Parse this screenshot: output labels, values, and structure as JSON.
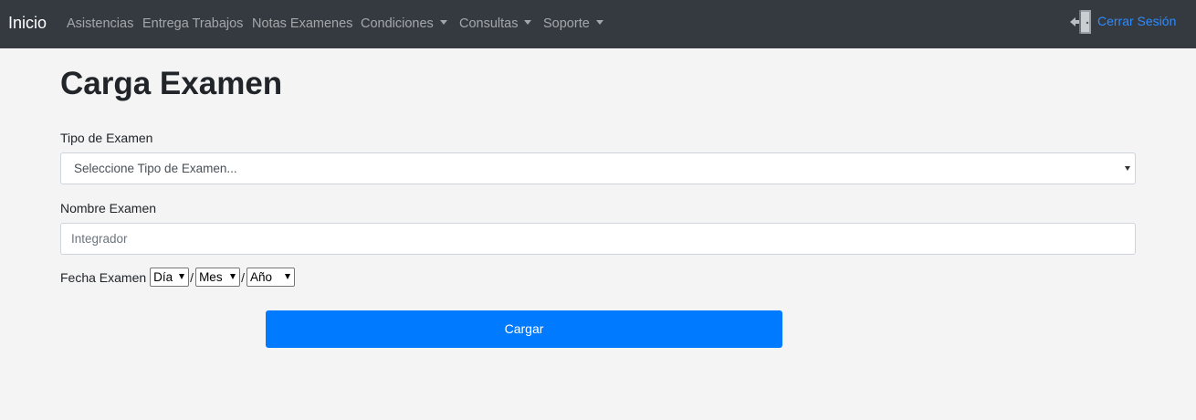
{
  "navbar": {
    "brand": "Inicio",
    "items": [
      {
        "label": "Asistencias",
        "dropdown": false
      },
      {
        "label": "Entrega Trabajos",
        "dropdown": false
      },
      {
        "label": "Notas Examenes",
        "dropdown": false
      },
      {
        "label": "Condiciones",
        "dropdown": true
      },
      {
        "label": "Consultas",
        "dropdown": true
      },
      {
        "label": "Soporte",
        "dropdown": true
      }
    ],
    "logout": {
      "label": "Cerrar Sesión",
      "icon": "door-exit-icon"
    }
  },
  "page": {
    "title": "Carga Examen"
  },
  "form": {
    "tipo_label": "Tipo de Examen",
    "tipo_selected": "Seleccione Tipo de Examen...",
    "nombre_label": "Nombre Examen",
    "nombre_placeholder": "Integrador",
    "fecha_label": "Fecha Examen",
    "dia": "Día",
    "mes": "Mes",
    "anio": "Año",
    "separator": "/",
    "submit_label": "Cargar"
  },
  "colors": {
    "navbar_bg": "#343a40",
    "page_bg": "#f4f4f4",
    "primary": "#007bff",
    "link": "#2f8bff"
  }
}
